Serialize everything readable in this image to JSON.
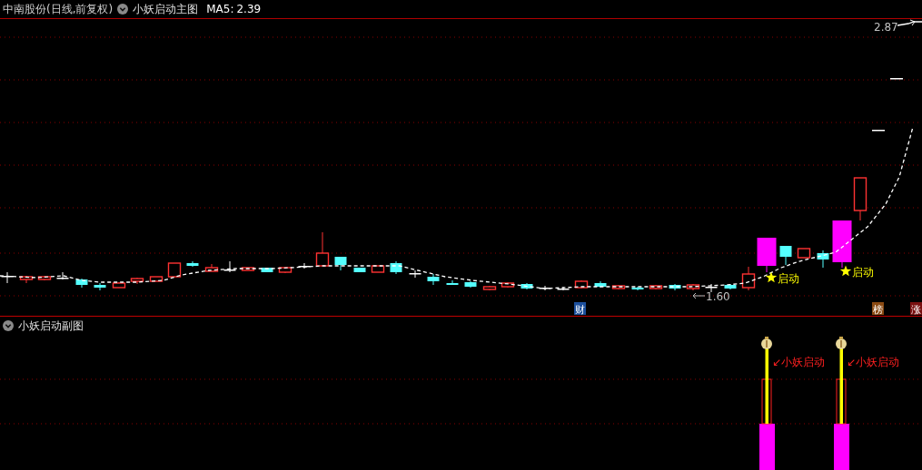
{
  "header": {
    "stock": "中南股份(日线,前复权)",
    "indicator": "小妖启动主图",
    "ma_label": "MA5:",
    "ma_value": "2.39"
  },
  "main_chart": {
    "high_marker": "2.87",
    "low_marker": "1.60",
    "signals": [
      {
        "label": "启动"
      },
      {
        "label": "启动"
      }
    ],
    "tags": [
      {
        "text": "财",
        "color": "#1c4f9c"
      },
      {
        "text": "榜",
        "color": "#8a4a12"
      },
      {
        "text": "涨",
        "color": "#7a1010"
      }
    ]
  },
  "sub_chart": {
    "title": "小妖启动副图",
    "signals": [
      {
        "label": "↙小妖启动"
      },
      {
        "label": "↙小妖启动"
      }
    ]
  }
}
